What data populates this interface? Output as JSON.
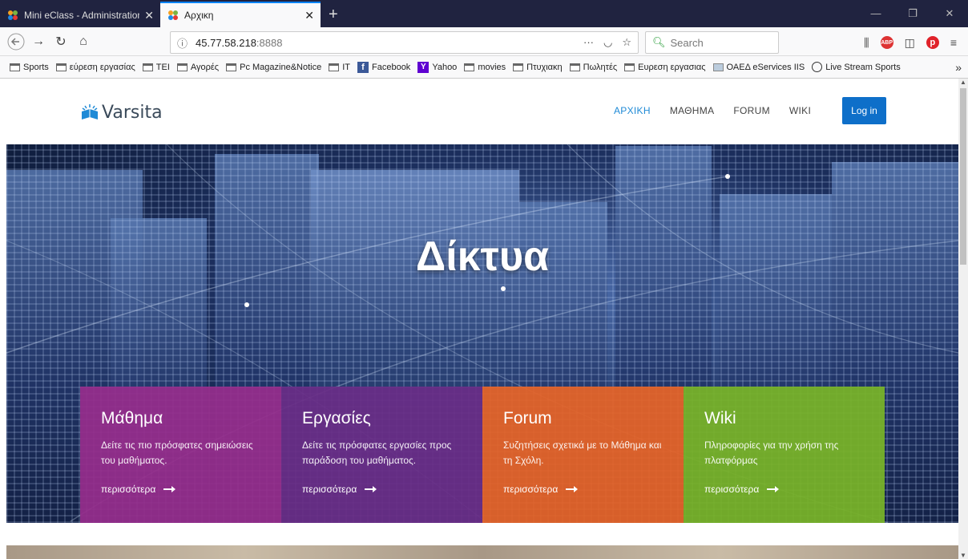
{
  "browser": {
    "tabs": [
      {
        "label": "Mini eClass - Administration - I"
      },
      {
        "label": "Αρχικη"
      }
    ],
    "url_host": "45.77.58.218",
    "url_port": ":8888",
    "search_placeholder": "Search",
    "bookmarks": [
      {
        "label": "Sports",
        "icon": "folder-icon"
      },
      {
        "label": "εύρεση εργασίας",
        "icon": "folder-icon"
      },
      {
        "label": "TEI",
        "icon": "folder-icon"
      },
      {
        "label": "Αγορές",
        "icon": "folder-icon"
      },
      {
        "label": "Pc Magazine&Notice",
        "icon": "folder-icon"
      },
      {
        "label": "IT",
        "icon": "folder-icon"
      },
      {
        "label": "Facebook",
        "icon": "facebook-icon"
      },
      {
        "label": "Yahoo",
        "icon": "yahoo-icon"
      },
      {
        "label": "movies",
        "icon": "folder-icon"
      },
      {
        "label": "Πτυχιακη",
        "icon": "folder-icon"
      },
      {
        "label": "Πωλητές",
        "icon": "folder-icon"
      },
      {
        "label": "Ευρεση εργασιας",
        "icon": "folder-icon"
      },
      {
        "label": "ΟΑΕΔ eServices IIS",
        "icon": "page-icon"
      },
      {
        "label": "Live Stream Sports",
        "icon": "globe-icon"
      }
    ]
  },
  "site": {
    "logo": "Varsita",
    "nav": [
      "ΑΡΧΙΚΗ",
      "ΜΑΘΗΜΑ",
      "FORUM",
      "WIKI"
    ],
    "login": "Log in",
    "hero_title": "Δίκτυα",
    "cards": [
      {
        "title": "Μάθημα",
        "text": "Δείτε τις πιο πρόσφατες σημειώσεις του μαθήματος.",
        "more": "περισσότερα",
        "color": "#962d8c"
      },
      {
        "title": "Εργασίες",
        "text": "Δείτε τις πρόσφατες εργασίες προς παράδοση του μαθήματος.",
        "more": "περισσότερα",
        "color": "#692d87"
      },
      {
        "title": "Forum",
        "text": "Συζητήσεις σχετικά με το Μάθημα και τη Σχόλη.",
        "more": "περισσότερα",
        "color": "#e66428"
      },
      {
        "title": "Wiki",
        "text": "Πληροφορίες για την χρήση της πλατφόρμας",
        "more": "περισσότερα",
        "color": "#78b428"
      }
    ]
  }
}
